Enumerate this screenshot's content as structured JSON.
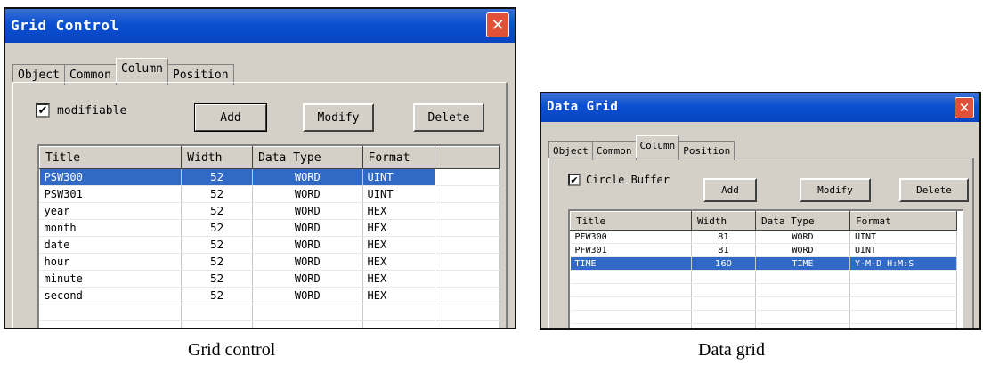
{
  "grid_control": {
    "title": "Grid Control",
    "close_label": "✕",
    "tabs": [
      "Object",
      "Common",
      "Column",
      "Position"
    ],
    "active_tab": "Column",
    "checkbox": {
      "label": "modifiable",
      "checked": true,
      "mark": "✔"
    },
    "buttons": {
      "add": "Add",
      "modify": "Modify",
      "delete": "Delete"
    },
    "columns": [
      "Title",
      "Width",
      "Data Type",
      "Format"
    ],
    "rows": [
      {
        "title": "PSW300",
        "width": "52",
        "data_type": "WORD",
        "format": "UINT",
        "selected": true
      },
      {
        "title": "PSW301",
        "width": "52",
        "data_type": "WORD",
        "format": "UINT"
      },
      {
        "title": "year",
        "width": "52",
        "data_type": "WORD",
        "format": "HEX"
      },
      {
        "title": "month",
        "width": "52",
        "data_type": "WORD",
        "format": "HEX"
      },
      {
        "title": "date",
        "width": "52",
        "data_type": "WORD",
        "format": "HEX"
      },
      {
        "title": "hour",
        "width": "52",
        "data_type": "WORD",
        "format": "HEX"
      },
      {
        "title": "minute",
        "width": "52",
        "data_type": "WORD",
        "format": "HEX"
      },
      {
        "title": "second",
        "width": "52",
        "data_type": "WORD",
        "format": "HEX"
      }
    ]
  },
  "data_grid": {
    "title": "Data Grid",
    "close_label": "✕",
    "tabs": [
      "Object",
      "Common",
      "Column",
      "Position"
    ],
    "active_tab": "Column",
    "checkbox": {
      "label": "Circle Buffer",
      "checked": true,
      "mark": "✔"
    },
    "buttons": {
      "add": "Add",
      "modify": "Modify",
      "delete": "Delete"
    },
    "columns": [
      "Title",
      "Width",
      "Data Type",
      "Format"
    ],
    "rows": [
      {
        "title": "PFW300",
        "width": "81",
        "data_type": "WORD",
        "format": "UINT"
      },
      {
        "title": "PFW301",
        "width": "81",
        "data_type": "WORD",
        "format": "UINT"
      },
      {
        "title": "TIME",
        "width": "160",
        "data_type": "TIME",
        "format": "Y-M-D H:M:S",
        "selected": true
      }
    ]
  },
  "captions": {
    "left": "Grid control",
    "right": "Data grid"
  },
  "colors": {
    "titlebar": "#0a50d0",
    "selection": "#3169c6",
    "dialog_bg": "#d4d0c8",
    "close_button": "#e0513a"
  }
}
